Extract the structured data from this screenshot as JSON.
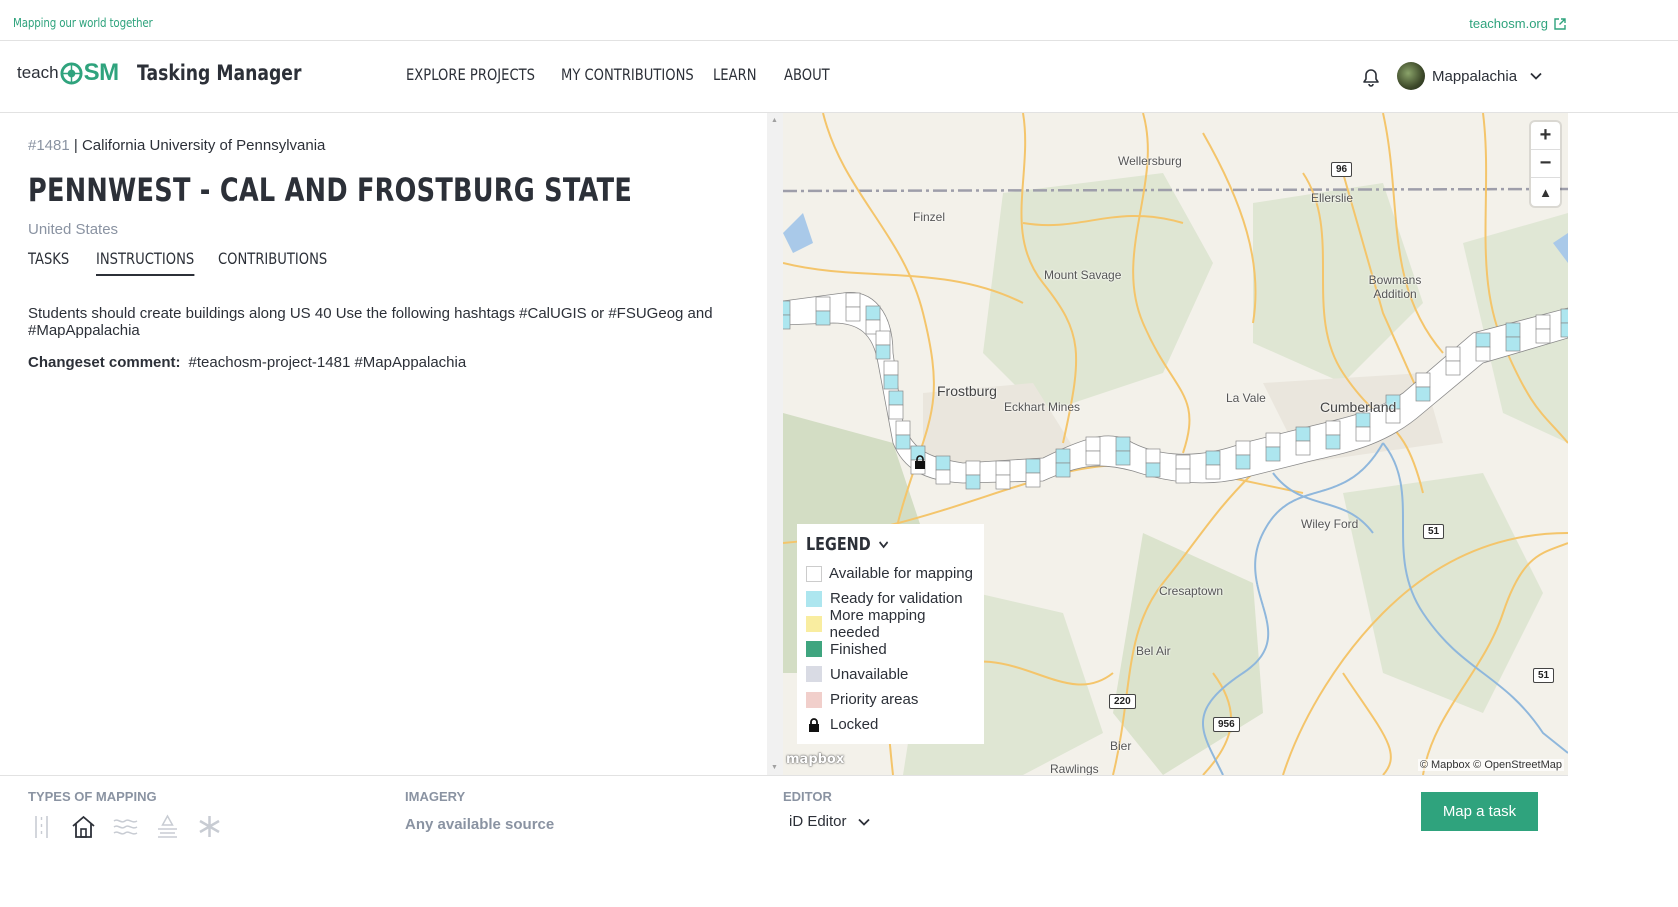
{
  "topbar": {
    "tagline": "Mapping our world together",
    "ext_link": "teachosm.org"
  },
  "header": {
    "logo_teach": "teach",
    "logo_osm": "SM",
    "app_title": "Tasking Manager",
    "nav": [
      "EXPLORE PROJECTS",
      "MY CONTRIBUTIONS",
      "LEARN",
      "ABOUT"
    ],
    "username": "Mappalachia"
  },
  "project": {
    "id": "#1481",
    "separator": " | ",
    "organisation": "California University of Pennsylvania",
    "title": "PENNWEST - CAL AND FROSTBURG STATE",
    "country": "United States",
    "tabs": [
      "TASKS",
      "INSTRUCTIONS",
      "CONTRIBUTIONS"
    ],
    "active_tab": "INSTRUCTIONS",
    "instructions": "Students should create buildings along US 40 Use the following hashtags #CalUGIS or #FSUGeog and #MapAppalachia",
    "changeset_label": "Changeset comment:",
    "changeset_value": "#teachosm-project-1481 #MapAppalachia"
  },
  "map": {
    "labels": {
      "wellersburg": "Wellersburg",
      "ellerslie": "Ellerslie",
      "finzel": "Finzel",
      "mount_savage": "Mount Savage",
      "bowmans_addition": "Bowmans Addition",
      "frostburg": "Frostburg",
      "eckhart_mines": "Eckhart Mines",
      "la_vale": "La Vale",
      "cumberland": "Cumberland",
      "wiley_ford": "Wiley Ford",
      "cresaptown": "Cresaptown",
      "bel_air": "Bel Air",
      "bier": "Bier",
      "rawlings": "Rawlings"
    },
    "shields": {
      "s96": "96",
      "s51a": "51",
      "s51b": "51",
      "s220": "220",
      "s956": "956"
    },
    "zoom_in": "+",
    "zoom_out": "−",
    "compass": "▲",
    "mapbox_logo": "mapbox",
    "credit": "© Mapbox © OpenStreetMap",
    "legend": {
      "title": "LEGEND",
      "items": [
        {
          "label": "Available for mapping",
          "color": "#ffffff"
        },
        {
          "label": "Ready for validation",
          "color": "#ade6ef"
        },
        {
          "label": "More mapping needed",
          "color": "#f9eda0"
        },
        {
          "label": "Finished",
          "color": "#3fa57f"
        },
        {
          "label": "Unavailable",
          "color": "#d9dbe4"
        },
        {
          "label": "Priority areas",
          "color": "#f1cfcb"
        },
        {
          "label": "Locked",
          "icon": "lock-icon"
        }
      ]
    }
  },
  "footer": {
    "types_label": "TYPES OF MAPPING",
    "types_icons": [
      "road-icon",
      "building-icon",
      "waterway-icon",
      "landuse-icon",
      "other-icon"
    ],
    "imagery_label": "IMAGERY",
    "imagery_value": "Any available source",
    "editor_label": "EDITOR",
    "editor_value": "iD Editor",
    "map_button": "Map a task"
  },
  "colors": {
    "accent": "#2fa37d",
    "text": "#2c3038",
    "muted": "#8a93a2"
  }
}
